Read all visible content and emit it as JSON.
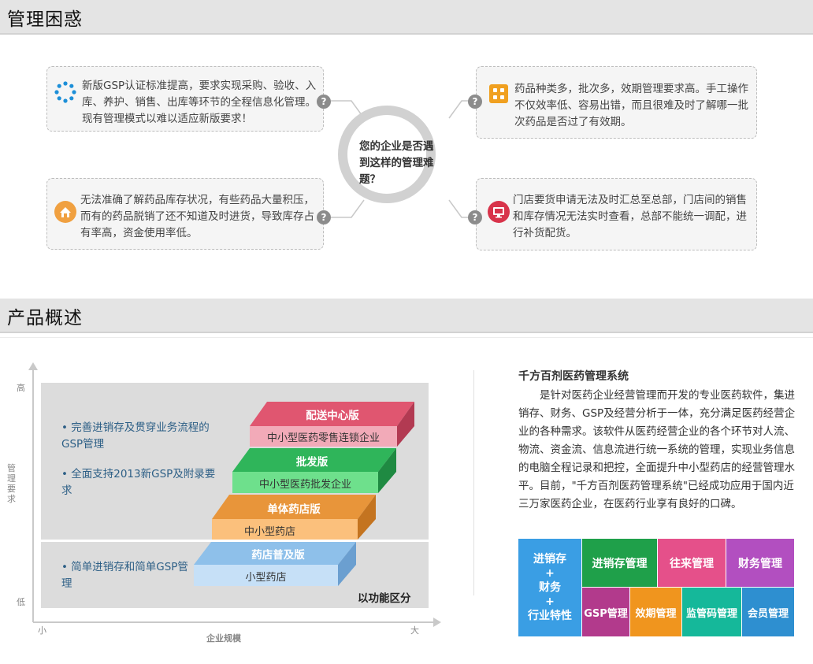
{
  "sections": {
    "problems_title": "管理困惑",
    "overview_title": "产品概述"
  },
  "problems": {
    "center_question": "您的企业是否遇到这样的管理难题？",
    "items": [
      {
        "icon": "circle-dots-icon",
        "text": "新版GSP认证标准提高，要求实现采购、验收、入库、养护、销售、出库等环节的全程信息化管理。现有管理模式以难以适应新版要求！"
      },
      {
        "icon": "grid-icon",
        "text": "药品种类多，批次多，效期管理要求高。手工操作不仅效率低、容易出错，而且很难及时了解哪一批次药品是否过了有效期。"
      },
      {
        "icon": "house-icon",
        "text": "无法准确了解药品库存状况，有些药品大量积压，而有的药品脱销了还不知道及时进货，导致库存占有率高，资金使用率低。"
      },
      {
        "icon": "monitor-icon",
        "text": "门店要货申请无法及时汇总至总部，门店间的销售和库存情况无法实时查看，总部不能统一调配，进行补货配货。"
      }
    ],
    "qmark": "?"
  },
  "overview": {
    "axis": {
      "high": "高",
      "low": "低",
      "small": "小",
      "large": "大",
      "y_title": "管理要求",
      "x_title": "企业规模"
    },
    "features": [
      "• 完善进销存及贯穿业务流程的GSP管理",
      "• 全面支持2013新GSP及附录要求",
      "• 简单进销存和简单GSP管理"
    ],
    "steps": [
      {
        "top": "配送中心版",
        "sub": "中小型医药零售连锁企业"
      },
      {
        "top": "批发版",
        "sub": "中小型医药批发企业"
      },
      {
        "top": "单体药店版",
        "sub": "中小型药店"
      },
      {
        "top": "药店普及版",
        "sub": "小型药店"
      }
    ],
    "by_function": "以功能区分",
    "product_title": "千方百剂医药管理系统",
    "product_desc": "是针对医药企业经营管理而开发的专业医药软件，集进销存、财务、GSP及经营分析于一体，充分满足医药经营企业的各种需求。该软件从医药经营企业的各个环节对人流、物流、资金流、信息流进行统一系统的管理，实现业务信息的电脑全程记录和把控，全面提升中小型药店的经营管理水平。目前，\"千方百剂医药管理系统\"已经成功应用于国内近三万家医药企业，在医药行业享有良好的口碑。",
    "modules": {
      "big": [
        "进销存",
        "+",
        "财务",
        "+",
        "行业特性"
      ],
      "top": [
        "进销存管理",
        "往来管理",
        "财务管理"
      ],
      "bottom": [
        "GSP管理",
        "效期管理",
        "监管码管理",
        "会员管理"
      ]
    }
  },
  "colors": {
    "step1": "#e05670",
    "step2": "#2fb55a",
    "step3": "#e8953a",
    "step4": "#8ec0ea",
    "mod_big": "#3a9ee4",
    "mod_green": "#1fa04a",
    "mod_pink": "#e5508a",
    "mod_purple": "#b24fc0",
    "mod_magenta": "#b23a8c",
    "mod_orange": "#f0951e",
    "mod_teal": "#15b89a",
    "mod_blue": "#2e8fd0"
  }
}
